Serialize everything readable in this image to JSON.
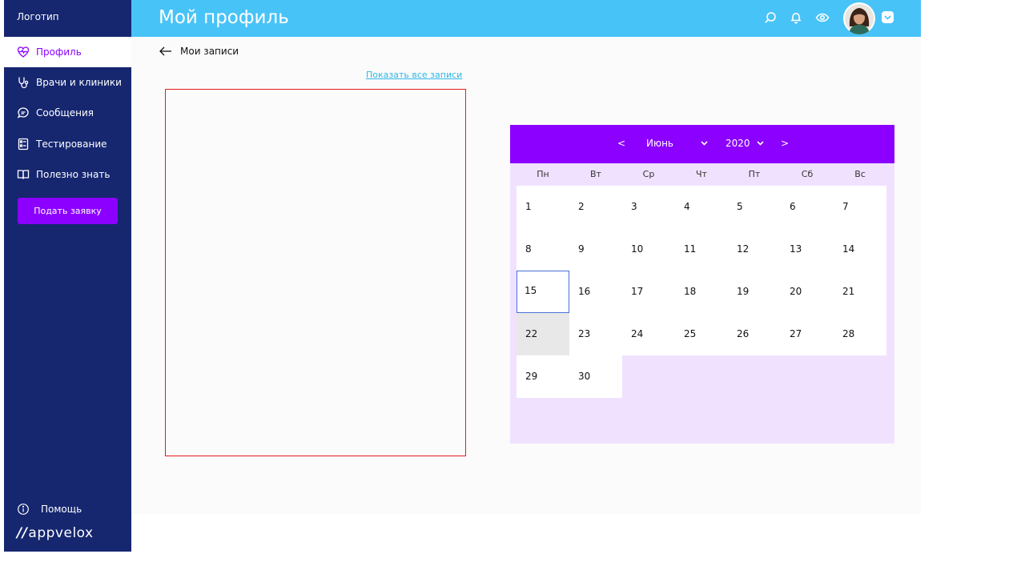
{
  "sidebar": {
    "logo": "Логотип",
    "items": [
      {
        "label": "Профиль",
        "icon": "heart-pulse-icon",
        "active": true
      },
      {
        "label": "Врачи и клиники",
        "icon": "stethoscope-icon",
        "active": false
      },
      {
        "label": "Сообщения",
        "icon": "chat-icon",
        "active": false
      },
      {
        "label": "Тестирование",
        "icon": "checklist-icon",
        "active": false
      },
      {
        "label": "Полезно знать",
        "icon": "book-icon",
        "active": false
      }
    ],
    "submit_label": "Подать заявку",
    "help_label": "Помощь",
    "brand_slashes": "//",
    "brand_name": "appvelox"
  },
  "header": {
    "title": "Мой профиль",
    "icons": [
      "search-icon",
      "bell-icon",
      "eye-icon",
      "avatar",
      "chevron-down-icon"
    ]
  },
  "main": {
    "back_label": "Мои записи",
    "show_all_link": "Показать все записи"
  },
  "calendar": {
    "prev": "<",
    "next": ">",
    "month": "Июнь",
    "year": "2020",
    "weekdays": [
      "Пн",
      "Вт",
      "Ср",
      "Чт",
      "Пт",
      "Сб",
      "Вс"
    ],
    "days": [
      "1",
      "2",
      "3",
      "4",
      "5",
      "6",
      "7",
      "8",
      "9",
      "10",
      "11",
      "12",
      "13",
      "14",
      "15",
      "16",
      "17",
      "18",
      "19",
      "20",
      "21",
      "22",
      "23",
      "24",
      "25",
      "26",
      "27",
      "28",
      "29",
      "30"
    ],
    "today": "15",
    "highlighted": "22"
  },
  "colors": {
    "sidebar_bg": "#162770",
    "header_bg": "#48c3f8",
    "accent": "#8b00ff",
    "calendar_bg": "#f0e2ff",
    "link": "#2fb6e8",
    "records_border": "#e51c1c"
  }
}
